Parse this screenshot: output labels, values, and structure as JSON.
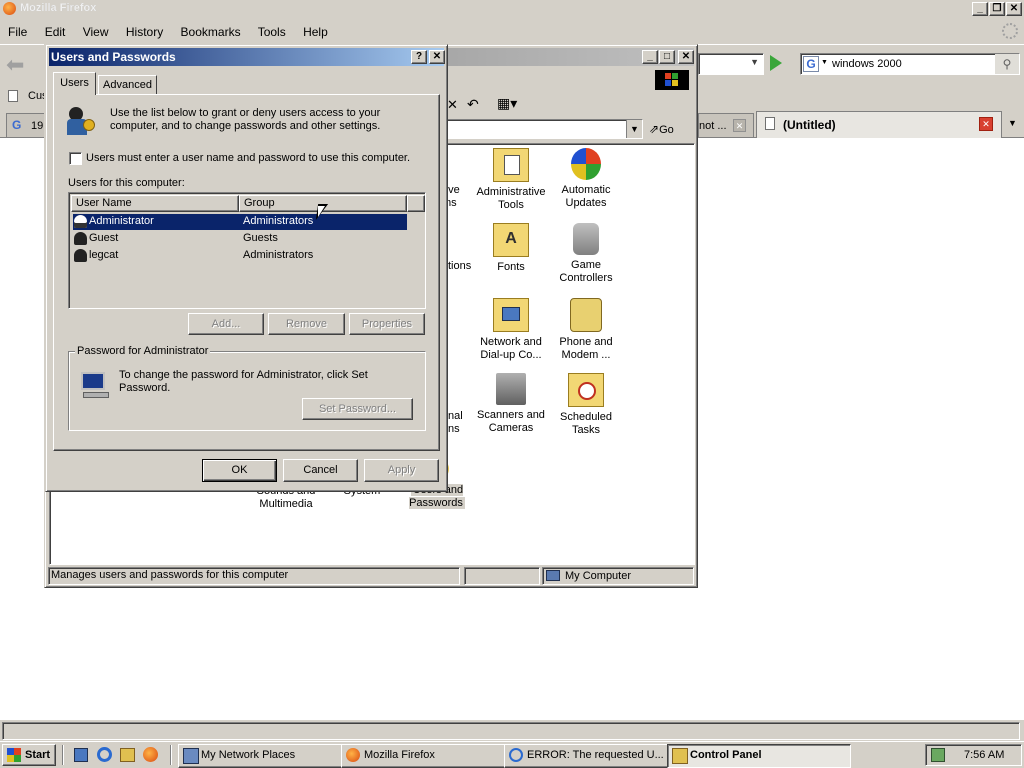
{
  "firefox": {
    "title": "Mozilla Firefox",
    "menu": [
      "File",
      "Edit",
      "View",
      "History",
      "Bookmarks",
      "Tools",
      "Help"
    ],
    "search_value": "windows 2000",
    "bookmark_partial": "Cus",
    "tab_partial_left": "19",
    "tab_partial_mid": "not ...",
    "tab_active_label": "(Untitled)"
  },
  "control_panel": {
    "go_label": "Go",
    "status_text": "Manages users and passwords for this computer",
    "status_zone": "My Computer",
    "items": [
      {
        "label": "Add/Remove Programs",
        "visible": "ove\nms",
        "icon": "add-remove-icon"
      },
      {
        "label": "Administrative Tools",
        "visible": "Administrative\nTools",
        "icon": "admin-tools-icon"
      },
      {
        "label": "Automatic Updates",
        "visible": "Automatic\nUpdates",
        "icon": "windows-update-icon"
      },
      {
        "label": "Folder Options",
        "visible": "tions",
        "icon": "folder-options-icon"
      },
      {
        "label": "Fonts",
        "visible": "Fonts",
        "icon": "fonts-icon"
      },
      {
        "label": "Game Controllers",
        "visible": "Game\nControllers",
        "icon": "joystick-icon"
      },
      {
        "label": "Network and Dial-up Co...",
        "visible": "Network and\nDial-up Co...",
        "icon": "network-icon"
      },
      {
        "label": "Phone and Modem ...",
        "visible": "Phone and\nModem ...",
        "icon": "phone-icon"
      },
      {
        "label": "Regional Options",
        "visible": "nal\nns",
        "icon": "regional-icon"
      },
      {
        "label": "Scanners and Cameras",
        "visible": "Scanners and\nCameras",
        "icon": "scanner-icon"
      },
      {
        "label": "Scheduled Tasks",
        "visible": "Scheduled\nTasks",
        "icon": "scheduled-tasks-icon"
      },
      {
        "label": "Sounds and Multimedia",
        "visible": "Sounds and\nMultimedia",
        "icon": "sound-icon"
      },
      {
        "label": "System",
        "visible": "System",
        "icon": "system-icon"
      },
      {
        "label": "Users and Passwords",
        "visible": "Users and\nPasswords",
        "icon": "users-icon"
      }
    ]
  },
  "dialog": {
    "title": "Users and Passwords",
    "help_btn": "?",
    "close_btn": "X",
    "tabs": [
      "Users",
      "Advanced"
    ],
    "intro": "Use the list below to grant or deny users access to your computer, and to change passwords and other settings.",
    "checkbox_label": "Users must enter a user name and password to use this computer.",
    "checkbox_checked": false,
    "list_label": "Users for this computer:",
    "columns": [
      "User Name",
      "Group"
    ],
    "users": [
      {
        "name": "Administrator",
        "group": "Administrators",
        "selected": true
      },
      {
        "name": "Guest",
        "group": "Guests",
        "selected": false
      },
      {
        "name": "legcat",
        "group": "Administrators",
        "selected": false
      }
    ],
    "add_btn": "Add...",
    "remove_btn": "Remove",
    "properties_btn": "Properties",
    "password_group_title": "Password for Administrator",
    "password_text": "To change the password for Administrator, click Set Password.",
    "set_password_btn": "Set Password...",
    "ok_btn": "OK",
    "cancel_btn": "Cancel",
    "apply_btn": "Apply"
  },
  "taskbar": {
    "start": "Start",
    "tasks": [
      "My Network Places",
      "Mozilla Firefox",
      "ERROR: The requested U...",
      "Control Panel"
    ],
    "clock": "7:56 AM"
  }
}
